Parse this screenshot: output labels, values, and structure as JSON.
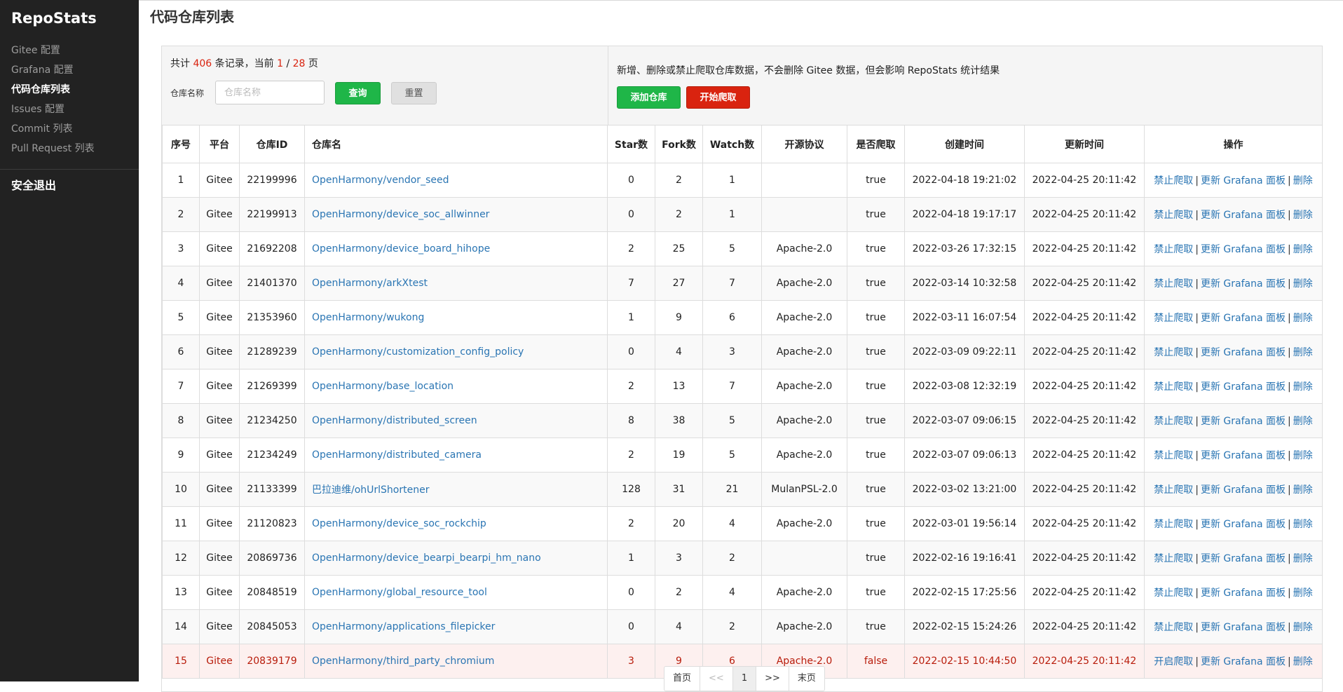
{
  "app": {
    "brand": "RepoStats"
  },
  "sidebar": {
    "items": [
      {
        "label": "Gitee 配置"
      },
      {
        "label": "Grafana 配置"
      },
      {
        "label": "代码仓库列表"
      },
      {
        "label": "Issues 配置"
      },
      {
        "label": "Commit 列表"
      },
      {
        "label": "Pull Request 列表"
      }
    ],
    "active_index": 2,
    "logout_label": "安全退出"
  },
  "page": {
    "title": "代码仓库列表"
  },
  "summary": {
    "prefix": "共计",
    "total": "406",
    "mid": "条记录，当前",
    "current_page": "1",
    "slash": "/",
    "total_pages": "28",
    "suffix": "页"
  },
  "search": {
    "label": "仓库名称",
    "placeholder": "仓库名称",
    "value": "",
    "query_label": "查询",
    "reset_label": "重置"
  },
  "actions": {
    "notice": "新增、删除或禁止爬取仓库数据，不会删除 Gitee 数据，但会影响 RepoStats 统计结果",
    "add_label": "添加仓库",
    "crawl_label": "开始爬取"
  },
  "table": {
    "headers": [
      "序号",
      "平台",
      "仓库ID",
      "仓库名",
      "Star数",
      "Fork数",
      "Watch数",
      "开源协议",
      "是否爬取",
      "创建时间",
      "更新时间",
      "操作"
    ],
    "rows": [
      {
        "no": "1",
        "platform": "Gitee",
        "id": "22199996",
        "name": "OpenHarmony/vendor_seed",
        "star": "0",
        "fork": "2",
        "watch": "1",
        "license": "",
        "crawl": "true",
        "created": "2022-04-18 19:21:02",
        "updated": "2022-04-25 20:11:42",
        "op1": "禁止爬取"
      },
      {
        "no": "2",
        "platform": "Gitee",
        "id": "22199913",
        "name": "OpenHarmony/device_soc_allwinner",
        "star": "0",
        "fork": "2",
        "watch": "1",
        "license": "",
        "crawl": "true",
        "created": "2022-04-18 19:17:17",
        "updated": "2022-04-25 20:11:42",
        "op1": "禁止爬取"
      },
      {
        "no": "3",
        "platform": "Gitee",
        "id": "21692208",
        "name": "OpenHarmony/device_board_hihope",
        "star": "2",
        "fork": "25",
        "watch": "5",
        "license": "Apache-2.0",
        "crawl": "true",
        "created": "2022-03-26 17:32:15",
        "updated": "2022-04-25 20:11:42",
        "op1": "禁止爬取"
      },
      {
        "no": "4",
        "platform": "Gitee",
        "id": "21401370",
        "name": "OpenHarmony/arkXtest",
        "star": "7",
        "fork": "27",
        "watch": "7",
        "license": "Apache-2.0",
        "crawl": "true",
        "created": "2022-03-14 10:32:58",
        "updated": "2022-04-25 20:11:42",
        "op1": "禁止爬取"
      },
      {
        "no": "5",
        "platform": "Gitee",
        "id": "21353960",
        "name": "OpenHarmony/wukong",
        "star": "1",
        "fork": "9",
        "watch": "6",
        "license": "Apache-2.0",
        "crawl": "true",
        "created": "2022-03-11 16:07:54",
        "updated": "2022-04-25 20:11:42",
        "op1": "禁止爬取"
      },
      {
        "no": "6",
        "platform": "Gitee",
        "id": "21289239",
        "name": "OpenHarmony/customization_config_policy",
        "star": "0",
        "fork": "4",
        "watch": "3",
        "license": "Apache-2.0",
        "crawl": "true",
        "created": "2022-03-09 09:22:11",
        "updated": "2022-04-25 20:11:42",
        "op1": "禁止爬取"
      },
      {
        "no": "7",
        "platform": "Gitee",
        "id": "21269399",
        "name": "OpenHarmony/base_location",
        "star": "2",
        "fork": "13",
        "watch": "7",
        "license": "Apache-2.0",
        "crawl": "true",
        "created": "2022-03-08 12:32:19",
        "updated": "2022-04-25 20:11:42",
        "op1": "禁止爬取"
      },
      {
        "no": "8",
        "platform": "Gitee",
        "id": "21234250",
        "name": "OpenHarmony/distributed_screen",
        "star": "8",
        "fork": "38",
        "watch": "5",
        "license": "Apache-2.0",
        "crawl": "true",
        "created": "2022-03-07 09:06:15",
        "updated": "2022-04-25 20:11:42",
        "op1": "禁止爬取"
      },
      {
        "no": "9",
        "platform": "Gitee",
        "id": "21234249",
        "name": "OpenHarmony/distributed_camera",
        "star": "2",
        "fork": "19",
        "watch": "5",
        "license": "Apache-2.0",
        "crawl": "true",
        "created": "2022-03-07 09:06:13",
        "updated": "2022-04-25 20:11:42",
        "op1": "禁止爬取"
      },
      {
        "no": "10",
        "platform": "Gitee",
        "id": "21133399",
        "name": "巴拉迪维/ohUrlShortener",
        "star": "128",
        "fork": "31",
        "watch": "21",
        "license": "MulanPSL-2.0",
        "crawl": "true",
        "created": "2022-03-02 13:21:00",
        "updated": "2022-04-25 20:11:42",
        "op1": "禁止爬取"
      },
      {
        "no": "11",
        "platform": "Gitee",
        "id": "21120823",
        "name": "OpenHarmony/device_soc_rockchip",
        "star": "2",
        "fork": "20",
        "watch": "4",
        "license": "Apache-2.0",
        "crawl": "true",
        "created": "2022-03-01 19:56:14",
        "updated": "2022-04-25 20:11:42",
        "op1": "禁止爬取"
      },
      {
        "no": "12",
        "platform": "Gitee",
        "id": "20869736",
        "name": "OpenHarmony/device_bearpi_bearpi_hm_nano",
        "star": "1",
        "fork": "3",
        "watch": "2",
        "license": "",
        "crawl": "true",
        "created": "2022-02-16 19:16:41",
        "updated": "2022-04-25 20:11:42",
        "op1": "禁止爬取"
      },
      {
        "no": "13",
        "platform": "Gitee",
        "id": "20848519",
        "name": "OpenHarmony/global_resource_tool",
        "star": "0",
        "fork": "2",
        "watch": "4",
        "license": "Apache-2.0",
        "crawl": "true",
        "created": "2022-02-15 17:25:56",
        "updated": "2022-04-25 20:11:42",
        "op1": "禁止爬取"
      },
      {
        "no": "14",
        "platform": "Gitee",
        "id": "20845053",
        "name": "OpenHarmony/applications_filepicker",
        "star": "0",
        "fork": "4",
        "watch": "2",
        "license": "Apache-2.0",
        "crawl": "true",
        "created": "2022-02-15 15:24:26",
        "updated": "2022-04-25 20:11:42",
        "op1": "禁止爬取"
      },
      {
        "no": "15",
        "platform": "Gitee",
        "id": "20839179",
        "name": "OpenHarmony/third_party_chromium",
        "star": "3",
        "fork": "9",
        "watch": "6",
        "license": "Apache-2.0",
        "crawl": "false",
        "created": "2022-02-15 10:44:50",
        "updated": "2022-04-25 20:11:42",
        "op1": "开启爬取",
        "danger": true
      }
    ],
    "op_update_label": "更新 Grafana 面板",
    "op_delete_label": "删除",
    "op_separator": "|"
  },
  "pagination": {
    "first": "首页",
    "prev": "<<",
    "current": "1",
    "next": ">>",
    "last": "末页"
  },
  "colors": {
    "sidebar_bg": "#222222",
    "link": "#2a75b3",
    "success": "#1fb648",
    "danger": "#d9230f",
    "danger_row_bg": "#fdf0ef"
  }
}
